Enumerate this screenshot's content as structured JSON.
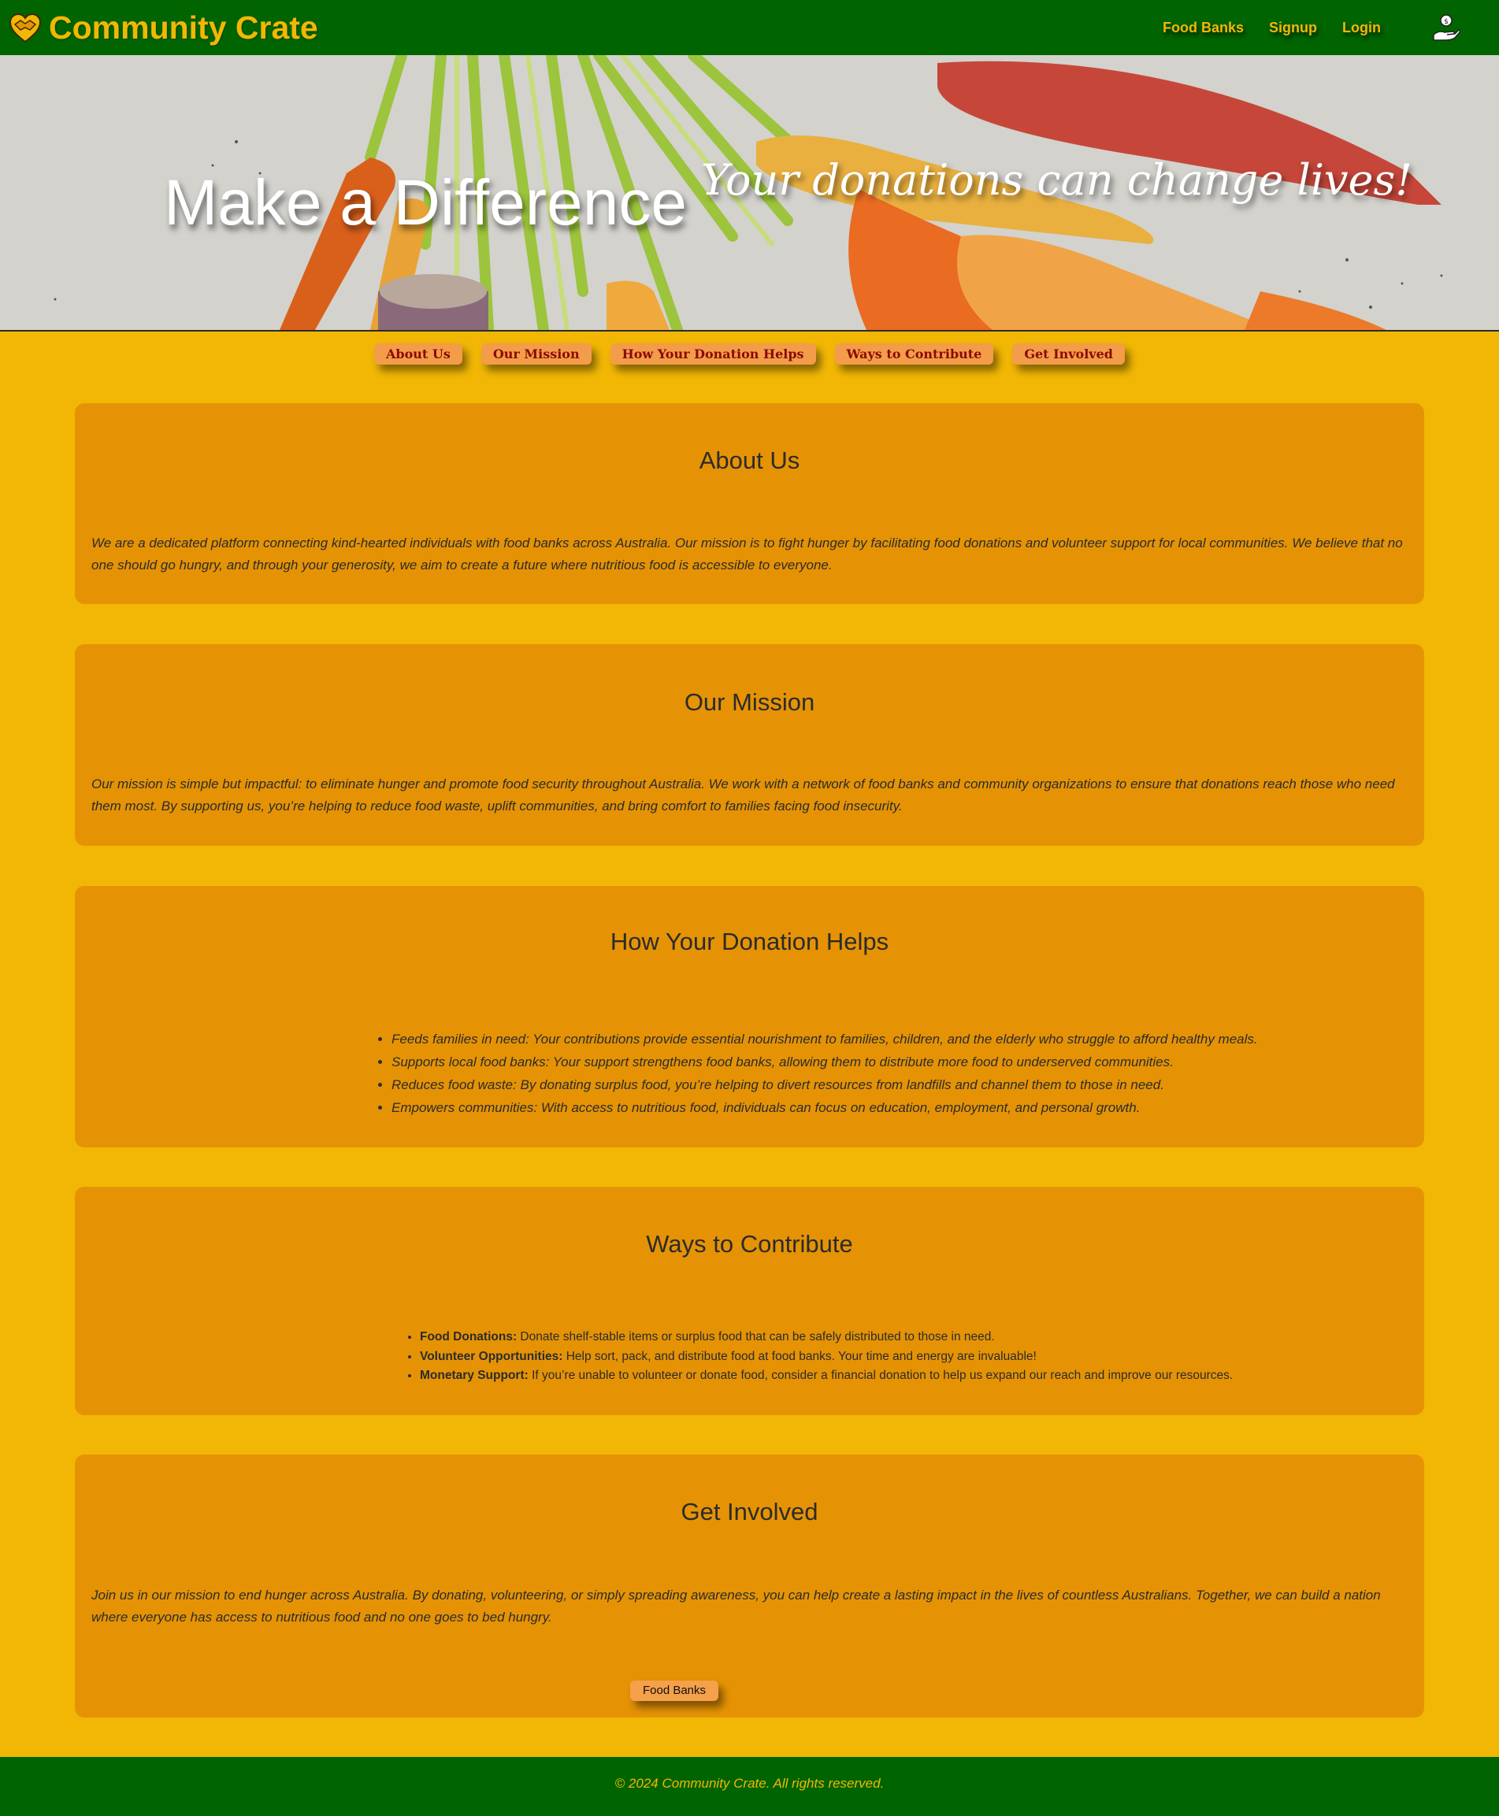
{
  "header": {
    "brand": "Community Crate",
    "nav": [
      "Food Banks",
      "Signup",
      "Login"
    ]
  },
  "hero": {
    "title": "Make a Difference",
    "subtitle": "Your donations can change lives!"
  },
  "section_nav": [
    "About Us",
    "Our Mission",
    "How Your Donation Helps",
    "Ways to Contribute",
    "Get Involved"
  ],
  "sections": {
    "about": {
      "title": "About Us",
      "text": "We are a dedicated platform connecting kind-hearted individuals with food banks across Australia. Our mission is to fight hunger by facilitating food donations and volunteer support for local communities. We believe that no one should go hungry, and through your generosity, we aim to create a future where nutritious food is accessible to everyone."
    },
    "mission": {
      "title": "Our Mission",
      "text": "Our mission is simple but impactful: to eliminate hunger and promote food security throughout Australia. We work with a network of food banks and community organizations to ensure that donations reach those who need them most. By supporting us, you’re helping to reduce food waste, uplift communities, and bring comfort to families facing food insecurity."
    },
    "helps": {
      "title": "How Your Donation Helps",
      "items": [
        "Feeds families in need: Your contributions provide essential nourishment to families, children, and the elderly who struggle to afford healthy meals.",
        "Supports local food banks: Your support strengthens food banks, allowing them to distribute more food to underserved communities.",
        "Reduces food waste: By donating surplus food, you’re helping to divert resources from landfills and channel them to those in need.",
        "Empowers communities: With access to nutritious food, individuals can focus on education, employment, and personal growth."
      ]
    },
    "contribute": {
      "title": "Ways to Contribute",
      "items": [
        {
          "label": "Food Donations:",
          "text": " Donate shelf-stable items or surplus food that can be safely distributed to those in need."
        },
        {
          "label": "Volunteer Opportunities:",
          "text": " Help sort, pack, and distribute food at food banks. Your time and energy are invaluable!"
        },
        {
          "label": "Monetary Support:",
          "text": " If you’re unable to volunteer or donate food, consider a financial donation to help us expand our reach and improve our resources."
        }
      ]
    },
    "involved": {
      "title": "Get Involved",
      "text": "Join us in our mission to end hunger across Australia. By donating, volunteering, or simply spreading awareness, you can help create a lasting impact in the lives of countless Australians. Together, we can build a nation where everyone has access to nutritious food and no one goes to bed hungry.",
      "button": "Food Banks"
    }
  },
  "footer": {
    "text": "© 2024 Community Crate. All rights reserved."
  },
  "colors": {
    "header_bg": "#006400",
    "page_bg": "#f2b705",
    "card_bg": "#e59305",
    "accent": "#f2b705"
  }
}
